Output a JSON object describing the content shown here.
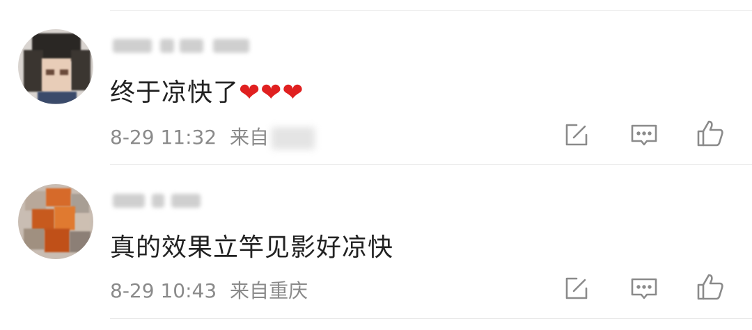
{
  "comments": [
    {
      "text": "终于凉快了",
      "emoji": "❤❤❤",
      "time": "8-29 11:32",
      "from_label": "来自",
      "location": ""
    },
    {
      "text": "真的效果立竿见影好凉快",
      "time": "8-29 10:43",
      "from_label": "来自",
      "location": "重庆"
    }
  ],
  "colors": {
    "text": "#222222",
    "meta": "#8a8a8a",
    "divider": "#e9e9e9",
    "heart": "#e02020"
  },
  "icons": [
    "edit-icon",
    "comment-icon",
    "like-icon"
  ]
}
